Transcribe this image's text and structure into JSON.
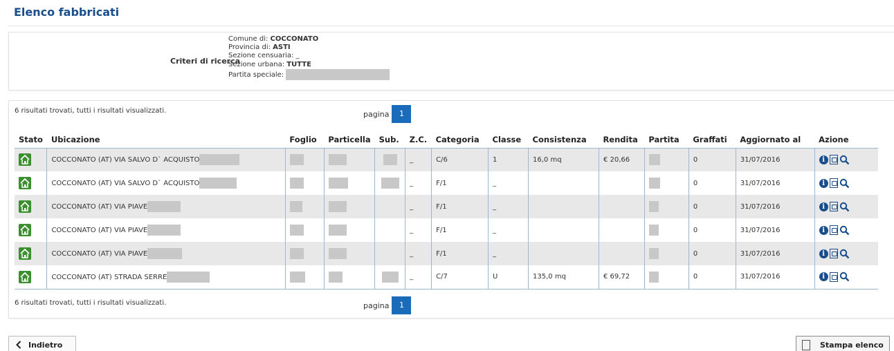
{
  "page": {
    "title": "Elenco fabbricati"
  },
  "criteria": {
    "label": "Criteri di ricerca",
    "comune_label": "Comune di:",
    "comune_value": "COCCONATO",
    "provincia_label": "Provincia di:",
    "provincia_value": "ASTI",
    "sezione_censuaria_label": "Sezione censuaria:",
    "sezione_censuaria_value": "_",
    "sezione_urbana_label": "Sezione urbana:",
    "sezione_urbana_value": "TUTTE",
    "partita_label": "Partita speciale:"
  },
  "results": {
    "count_text": "6 risultati trovati, tutti i risultati visualizzati.",
    "pager_label": "pagina",
    "current_page": "1",
    "columns": [
      "Stato",
      "Ubicazione",
      "Foglio",
      "Particella",
      "Sub.",
      "Z.C.",
      "Categoria",
      "Classe",
      "Consistenza",
      "Rendita",
      "Partita",
      "Graffati",
      "Aggiornato al",
      "Azione"
    ],
    "rows": [
      {
        "ubicazione": "COCCONATO (AT) VIA SALVO D` ACQUISTO",
        "zc": "_",
        "categoria": "C/6",
        "classe": "1",
        "consistenza": "16,0 mq",
        "rendita": "€ 20,66",
        "graffati": "0",
        "aggiornato": "31/07/2016"
      },
      {
        "ubicazione": "COCCONATO (AT) VIA SALVO D` ACQUISTO",
        "zc": "_",
        "categoria": "F/1",
        "classe": "_",
        "consistenza": "",
        "rendita": "",
        "graffati": "0",
        "aggiornato": "31/07/2016"
      },
      {
        "ubicazione": "COCCONATO (AT) VIA PIAVE",
        "zc": "_",
        "categoria": "F/1",
        "classe": "_",
        "consistenza": "",
        "rendita": "",
        "graffati": "0",
        "aggiornato": "31/07/2016"
      },
      {
        "ubicazione": "COCCONATO (AT) VIA PIAVE",
        "zc": "_",
        "categoria": "F/1",
        "classe": "_",
        "consistenza": "",
        "rendita": "",
        "graffati": "0",
        "aggiornato": "31/07/2016"
      },
      {
        "ubicazione": "COCCONATO (AT) VIA PIAVE",
        "zc": "_",
        "categoria": "F/1",
        "classe": "_",
        "consistenza": "",
        "rendita": "",
        "graffati": "0",
        "aggiornato": "31/07/2016"
      },
      {
        "ubicazione": "COCCONATO (AT) STRADA SERRE",
        "zc": "_",
        "categoria": "C/7",
        "classe": "U",
        "consistenza": "135,0 mq",
        "rendita": "€ 69,72",
        "graffati": "0",
        "aggiornato": "31/07/2016"
      }
    ]
  },
  "footer": {
    "back_label": "Indietro",
    "print_label": "Stampa elenco"
  },
  "icons": {
    "stato": "home-icon",
    "info": "info-icon",
    "pdf": "pdf-icon",
    "search": "search-icon",
    "back": "chevron-left-icon",
    "print": "pdf-icon"
  },
  "colors": {
    "title": "#1a4d8c",
    "page_badge": "#1a6cba",
    "home_icon": "#3c8f2f",
    "row_alt": "#e8e8e8"
  }
}
